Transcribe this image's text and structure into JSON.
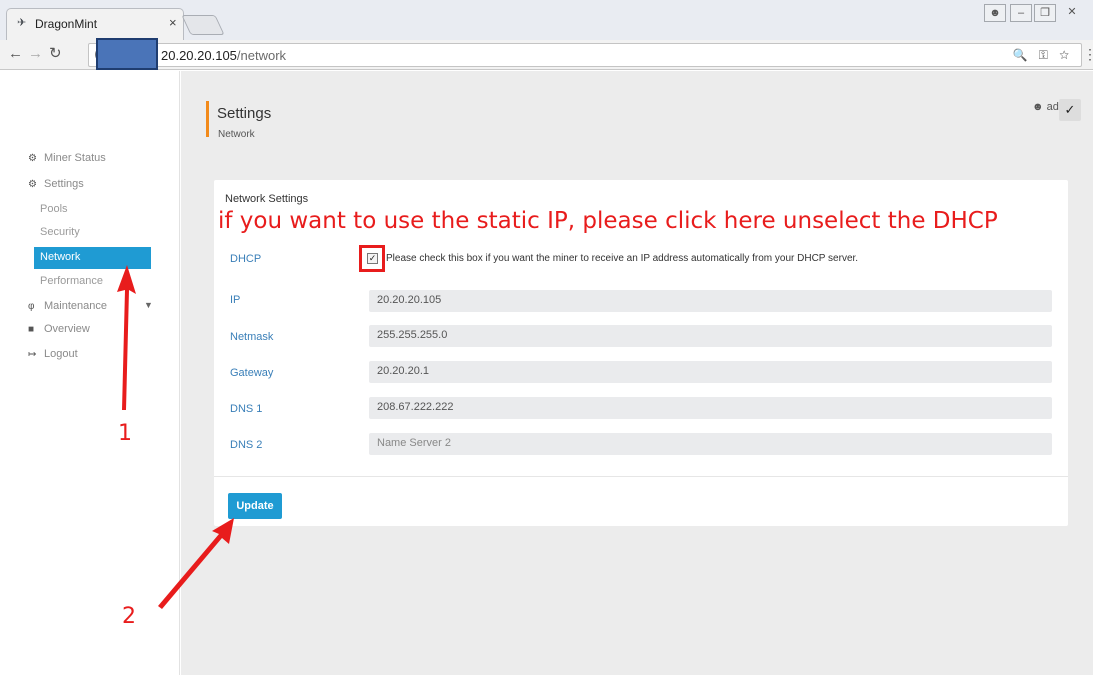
{
  "browser": {
    "tab_title": "DragonMint",
    "tab_close": "×",
    "url_host": "20.20.20.105",
    "url_path": "/network",
    "omni_icons": "🔍 ⚿ ☆",
    "menu": "⋮"
  },
  "sidebar": {
    "items": [
      {
        "label": "Miner Status",
        "icon": "dashboard-icon"
      },
      {
        "label": "Settings",
        "icon": "cogs-icon"
      },
      {
        "label": "Pools"
      },
      {
        "label": "Security"
      },
      {
        "label": "Network",
        "active": true
      },
      {
        "label": "Performance"
      },
      {
        "label": "Maintenance",
        "icon": "plug-icon"
      },
      {
        "label": "Overview",
        "icon": "chip-icon"
      },
      {
        "label": "Logout",
        "icon": "sign-out-icon"
      }
    ]
  },
  "header": {
    "title": "Settings",
    "subtitle": "Network",
    "user": "admin"
  },
  "card": {
    "title": "Network Settings",
    "dhcp_label": "DHCP",
    "dhcp_checked": true,
    "dhcp_hint": "Please check this box if you want the miner to receive an IP address automatically from your DHCP server.",
    "fields": [
      {
        "label": "IP",
        "value": "20.20.20.105"
      },
      {
        "label": "Netmask",
        "value": "255.255.255.0"
      },
      {
        "label": "Gateway",
        "value": "20.20.20.1"
      },
      {
        "label": "DNS 1",
        "value": "208.67.222.222"
      },
      {
        "label": "DNS 2",
        "placeholder": "Name Server 2"
      }
    ],
    "update_label": "Update"
  },
  "annotations": {
    "instruction": "if you want to use the static IP, please click here unselect the DHCP",
    "step1": "1",
    "step2": "2",
    "color": "#e81c1c"
  },
  "colors": {
    "accent": "#1f9bd3",
    "header_bar": "#f28a1a",
    "label": "#3a7fb8"
  }
}
